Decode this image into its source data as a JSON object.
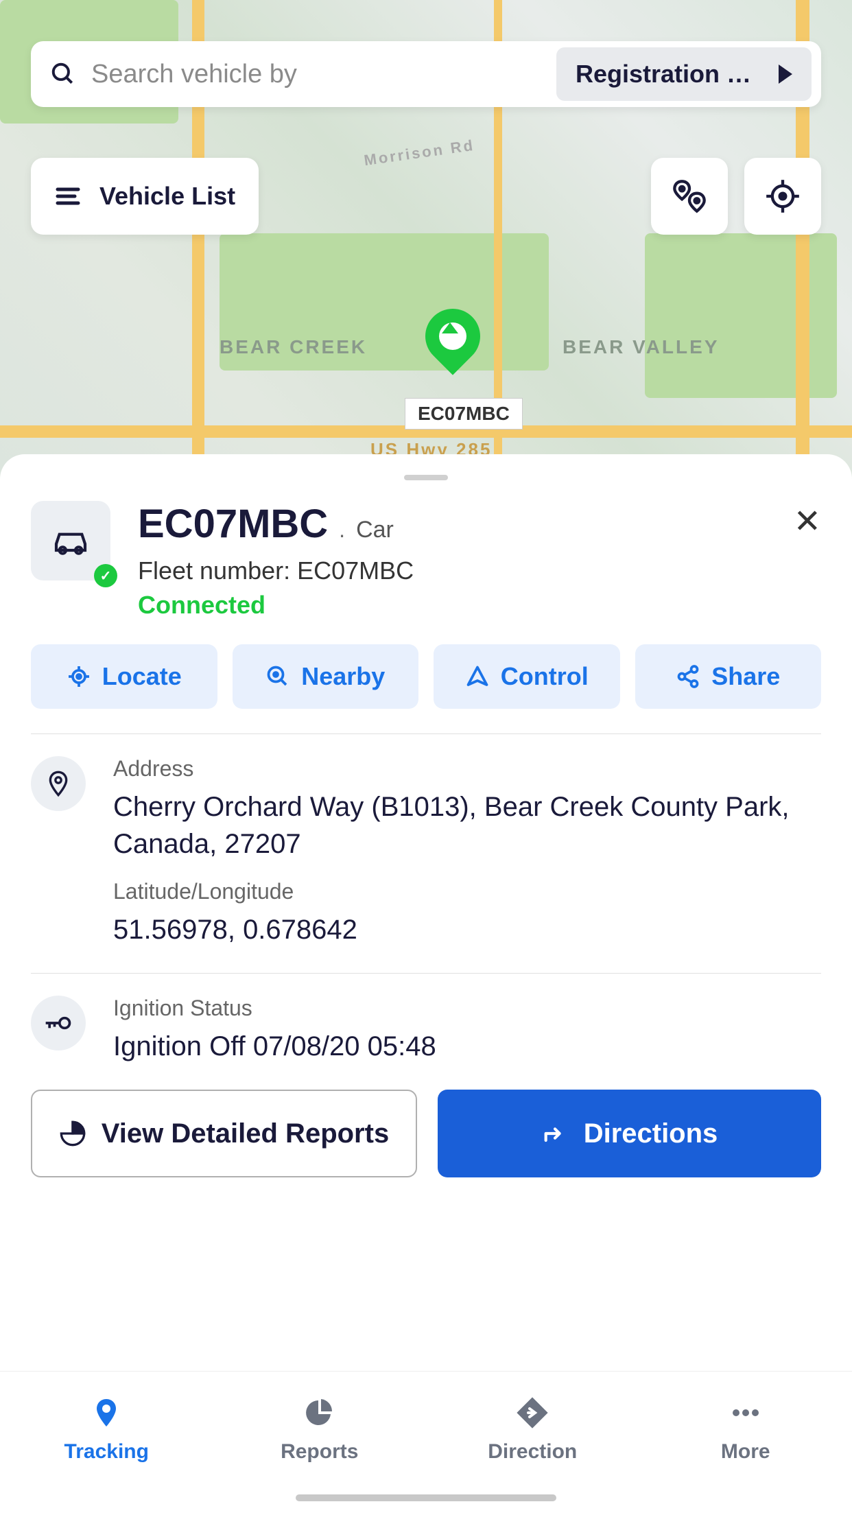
{
  "search": {
    "placeholder": "Search vehicle by",
    "dropdown_label": "Registration …"
  },
  "top_buttons": {
    "vehicle_list": "Vehicle List"
  },
  "map": {
    "label_bear_creek": "BEAR CREEK",
    "label_bear_valley": "BEAR VALLEY",
    "label_highway": "US Hwy 285",
    "label_morrison": "Morrison Rd",
    "pin_label": "EC07MBC"
  },
  "vehicle": {
    "registration": "EC07MBC",
    "type": "Car",
    "fleet_label": "Fleet number: EC07MBC",
    "status": "Connected"
  },
  "actions": {
    "locate": "Locate",
    "nearby": "Nearby",
    "control": "Control",
    "share": "Share"
  },
  "info": {
    "address_label": "Address",
    "address_value": "Cherry Orchard Way (B1013), Bear Creek County Park, Canada, 27207",
    "latlng_label": "Latitude/Longitude",
    "latlng_value": "51.56978, 0.678642",
    "ignition_label": "Ignition Status",
    "ignition_value": "Ignition Off 07/08/20 05:48"
  },
  "big_buttons": {
    "reports": "View Detailed Reports",
    "directions": "Directions"
  },
  "nav": {
    "tracking": "Tracking",
    "reports": "Reports",
    "direction": "Direction",
    "more": "More"
  },
  "colors": {
    "primary": "#1a73e8",
    "primary_dark": "#1a5fd8",
    "success": "#1cc93f",
    "navy": "#1a1a3a"
  }
}
